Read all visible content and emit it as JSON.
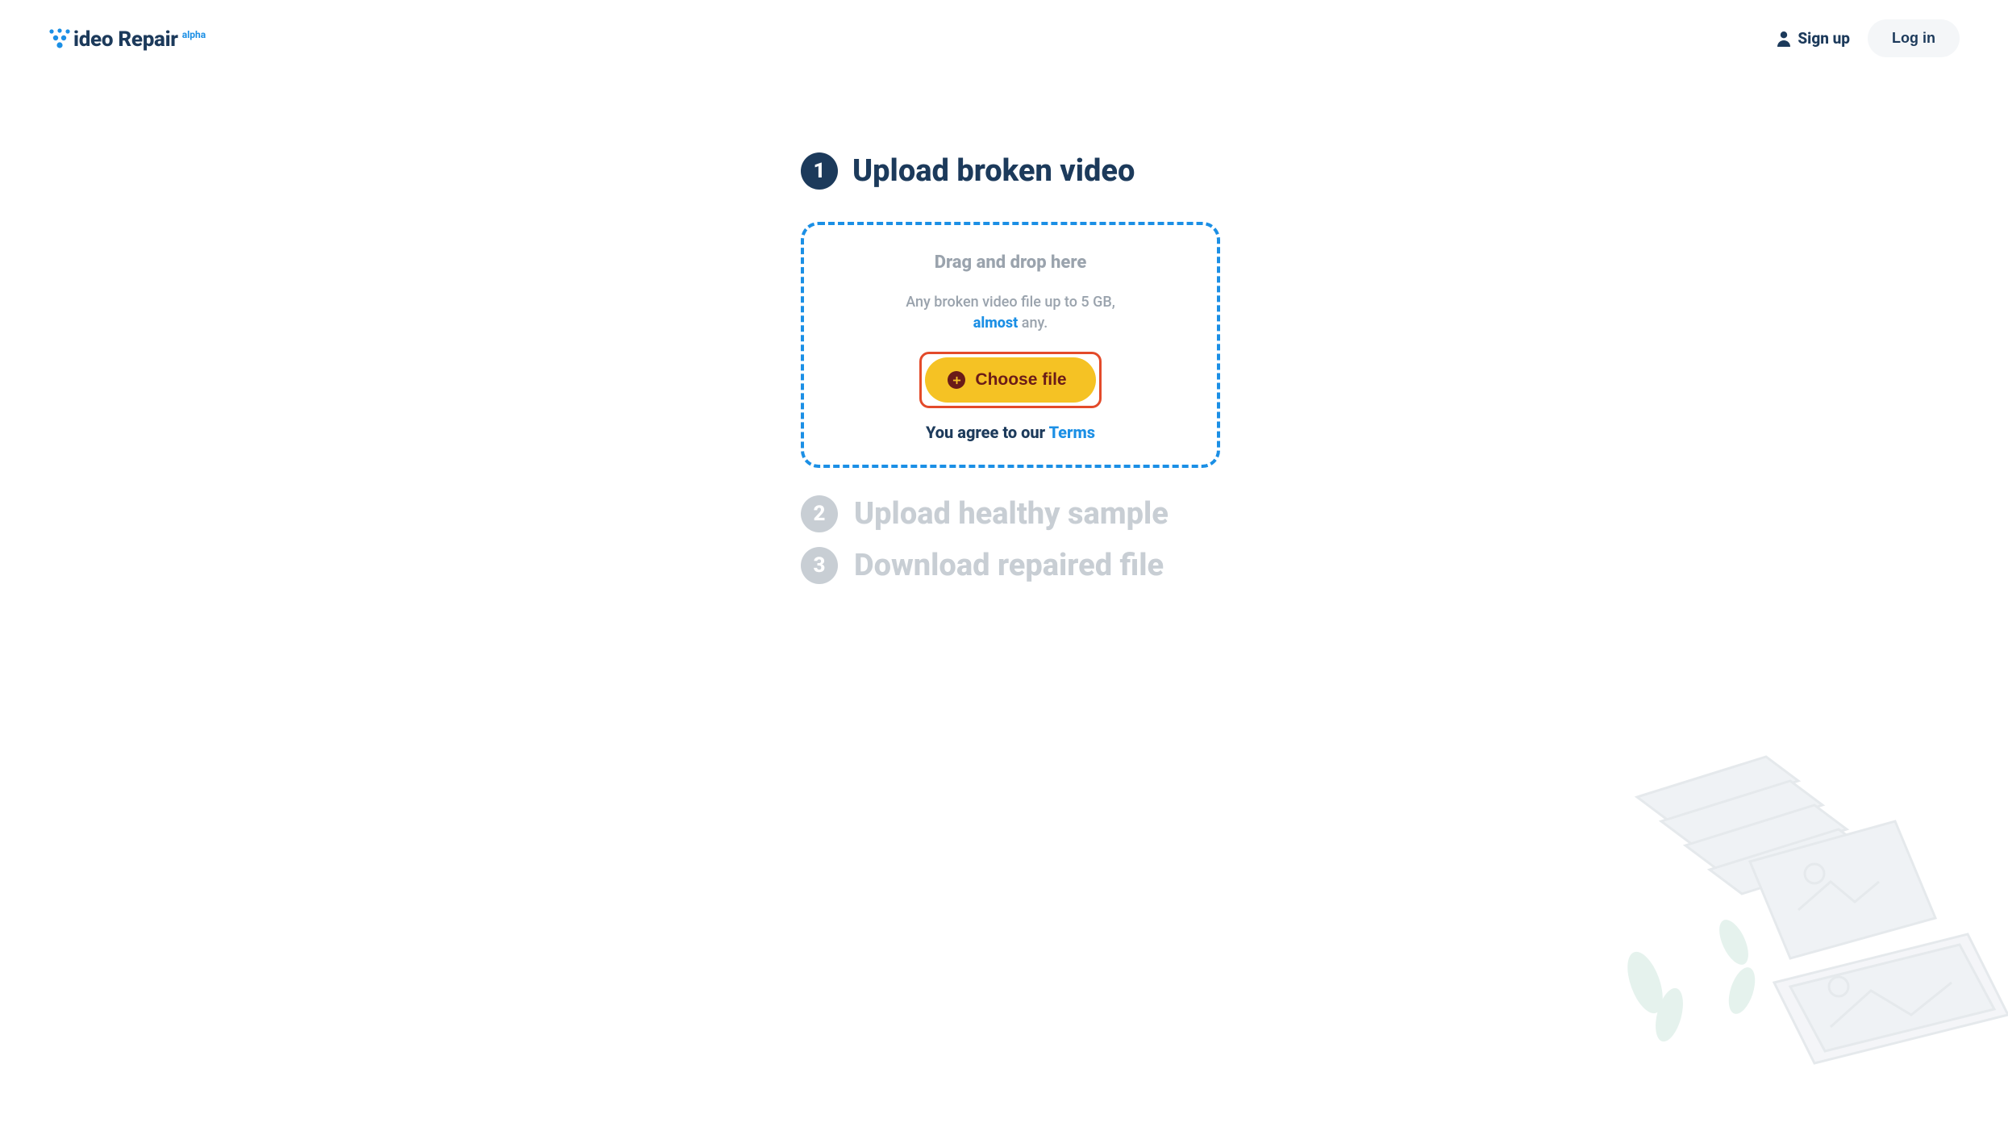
{
  "header": {
    "logo_text": "ideo Repair",
    "logo_alpha": "alpha",
    "signup_label": "Sign up",
    "login_label": "Log in"
  },
  "step1": {
    "badge": "1",
    "title": "Upload broken video",
    "drop_title": "Drag and drop here",
    "drop_sub_prefix": "Any broken video file up to 5 GB,",
    "drop_sub_almost": "almost",
    "drop_sub_suffix": " any.",
    "choose_label": "Choose file",
    "agree_prefix": "You agree to our ",
    "agree_terms": "Terms"
  },
  "step2": {
    "badge": "2",
    "title": "Upload healthy sample"
  },
  "step3": {
    "badge": "3",
    "title": "Download repaired file"
  }
}
